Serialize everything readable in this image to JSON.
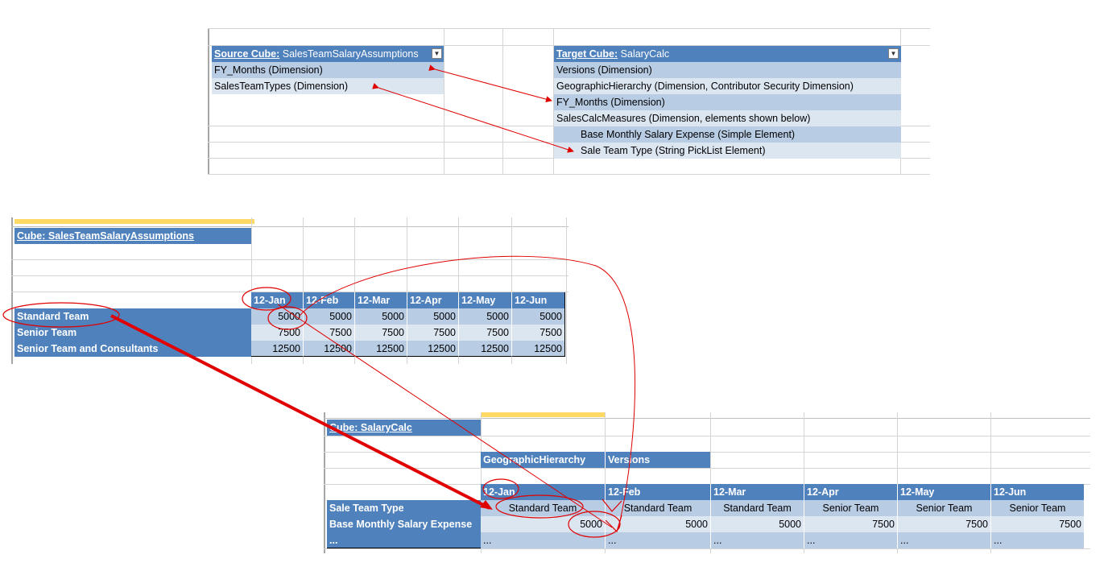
{
  "top": {
    "source_label": "Source Cube:",
    "source_name": "SalesTeamSalaryAssumptions",
    "source_items": [
      "FY_Months (Dimension)",
      "SalesTeamTypes (Dimension)"
    ],
    "target_label": "Target Cube:",
    "target_name": "SalaryCalc",
    "target_items": [
      "Versions (Dimension)",
      "GeographicHierarchy (Dimension, Contributor Security Dimension)",
      "FY_Months (Dimension)",
      "SalesCalcMeasures (Dimension, elements shown below)",
      "Base Monthly Salary Expense (Simple Element)",
      "Sale Team Type (String PickList Element)"
    ]
  },
  "middle": {
    "cube_label": "Cube: SalesTeamSalaryAssumptions",
    "months": [
      "12-Jan",
      "12-Feb",
      "12-Mar",
      "12-Apr",
      "12-May",
      "12-Jun"
    ],
    "rows": [
      {
        "label": "Standard Team",
        "values": [
          "5000",
          "5000",
          "5000",
          "5000",
          "5000",
          "5000"
        ]
      },
      {
        "label": "Senior Team",
        "values": [
          "7500",
          "7500",
          "7500",
          "7500",
          "7500",
          "7500"
        ]
      },
      {
        "label": "Senior Team and Consultants",
        "values": [
          "12500",
          "12500",
          "12500",
          "12500",
          "12500",
          "12500"
        ]
      }
    ]
  },
  "bottom": {
    "cube_label": "Cube: SalaryCalc",
    "geo_label": "GeographicHierarchy",
    "versions_label": "Versions",
    "months": [
      "12-Jan",
      "12-Feb",
      "12-Mar",
      "12-Apr",
      "12-May",
      "12-Jun"
    ],
    "row1_label": "Sale Team Type",
    "row1_values": [
      "Standard Team",
      "Standard Team",
      "Standard Team",
      "Senior Team",
      "Senior Team",
      "Senior Team"
    ],
    "row2_label": "Base Monthly Salary Expense",
    "row2_values": [
      "5000",
      "5000",
      "5000",
      "7500",
      "7500",
      "7500"
    ],
    "row3_label": "...",
    "row3_values": [
      "...",
      "...",
      "...",
      "...",
      "...",
      "..."
    ]
  },
  "colors": {
    "header_blue": "#4f81bd",
    "light_blue": "#b8cce4",
    "lighter_blue": "#dce6f1",
    "annotation_red": "#e00000",
    "selection_yellow": "#ffd966"
  }
}
